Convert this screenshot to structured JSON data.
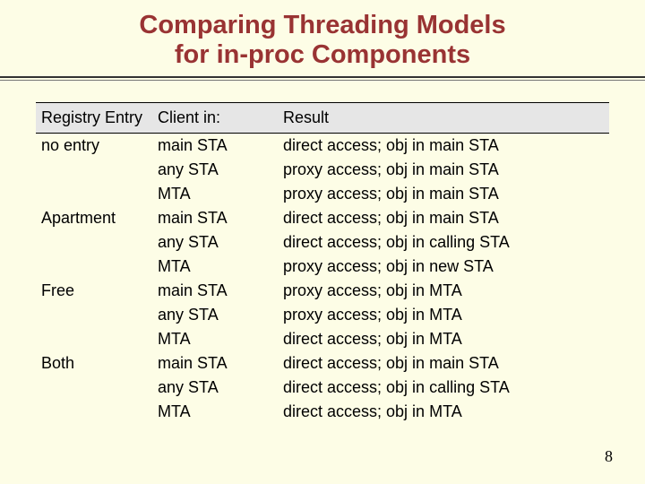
{
  "title_line1": "Comparing Threading Models",
  "title_line2": "for in-proc Components",
  "page_number": "8",
  "headers": {
    "registry": "Registry Entry",
    "client": "Client in:",
    "result": "Result"
  },
  "rows": [
    {
      "registry": "no entry",
      "client": "main STA",
      "result": "direct access; obj in main STA"
    },
    {
      "registry": "",
      "client": "any STA",
      "result": "proxy access; obj in main STA"
    },
    {
      "registry": "",
      "client": "MTA",
      "result": "proxy access; obj in main STA"
    },
    {
      "registry": "Apartment",
      "client": "main STA",
      "result": "direct access; obj in main STA"
    },
    {
      "registry": "",
      "client": "any STA",
      "result": "direct access; obj in calling STA"
    },
    {
      "registry": "",
      "client": "MTA",
      "result": "proxy access; obj in new STA"
    },
    {
      "registry": "Free",
      "client": "main STA",
      "result": "proxy access; obj in MTA"
    },
    {
      "registry": "",
      "client": "any STA",
      "result": "proxy access; obj in MTA"
    },
    {
      "registry": "",
      "client": "MTA",
      "result": "direct access; obj in MTA"
    },
    {
      "registry": "Both",
      "client": "main STA",
      "result": "direct access; obj in main STA"
    },
    {
      "registry": "",
      "client": "any STA",
      "result": "direct access; obj in calling STA"
    },
    {
      "registry": "",
      "client": "MTA",
      "result": "direct access; obj in MTA"
    }
  ]
}
